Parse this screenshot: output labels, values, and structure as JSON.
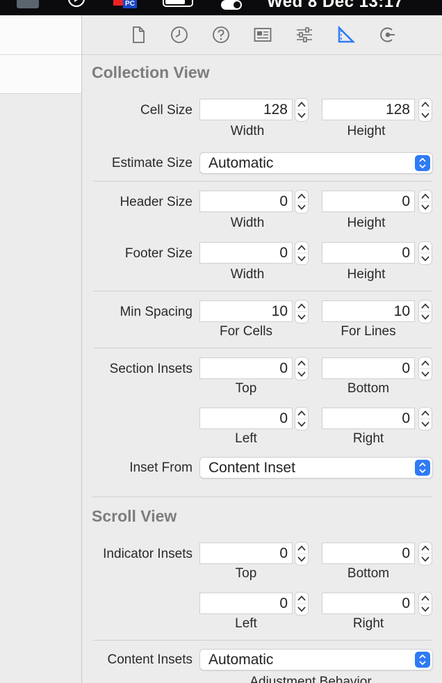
{
  "menubar": {
    "clock": "Wed 8 Dec  13:17",
    "badge_text": "PC"
  },
  "toolbar": {
    "icons": [
      "file-icon",
      "history-icon",
      "help-icon",
      "identity-icon",
      "attributes-icon",
      "size-ruler-icon",
      "connections-icon"
    ],
    "selected": "size-ruler-icon",
    "accent": "#2f7bf5"
  },
  "collection_view": {
    "title": "Collection View",
    "cell_size": {
      "label": "Cell Size",
      "width": "128",
      "height": "128",
      "width_caption": "Width",
      "height_caption": "Height"
    },
    "estimate_size": {
      "label": "Estimate Size",
      "value": "Automatic"
    },
    "header_size": {
      "label": "Header Size",
      "width": "0",
      "height": "0",
      "width_caption": "Width",
      "height_caption": "Height"
    },
    "footer_size": {
      "label": "Footer Size",
      "width": "0",
      "height": "0",
      "width_caption": "Width",
      "height_caption": "Height"
    },
    "min_spacing": {
      "label": "Min Spacing",
      "cells": "10",
      "lines": "10",
      "cells_caption": "For Cells",
      "lines_caption": "For Lines"
    },
    "section_insets": {
      "label": "Section Insets",
      "top": "0",
      "bottom": "0",
      "left": "0",
      "right": "0",
      "top_caption": "Top",
      "bottom_caption": "Bottom",
      "left_caption": "Left",
      "right_caption": "Right"
    },
    "inset_from": {
      "label": "Inset From",
      "value": "Content Inset"
    }
  },
  "scroll_view": {
    "title": "Scroll View",
    "indicator_insets": {
      "label": "Indicator Insets",
      "top": "0",
      "bottom": "0",
      "left": "0",
      "right": "0",
      "top_caption": "Top",
      "bottom_caption": "Bottom",
      "left_caption": "Left",
      "right_caption": "Right"
    },
    "content_insets": {
      "label": "Content Insets",
      "value": "Automatic",
      "caption": "Adjustment Behavior"
    }
  }
}
